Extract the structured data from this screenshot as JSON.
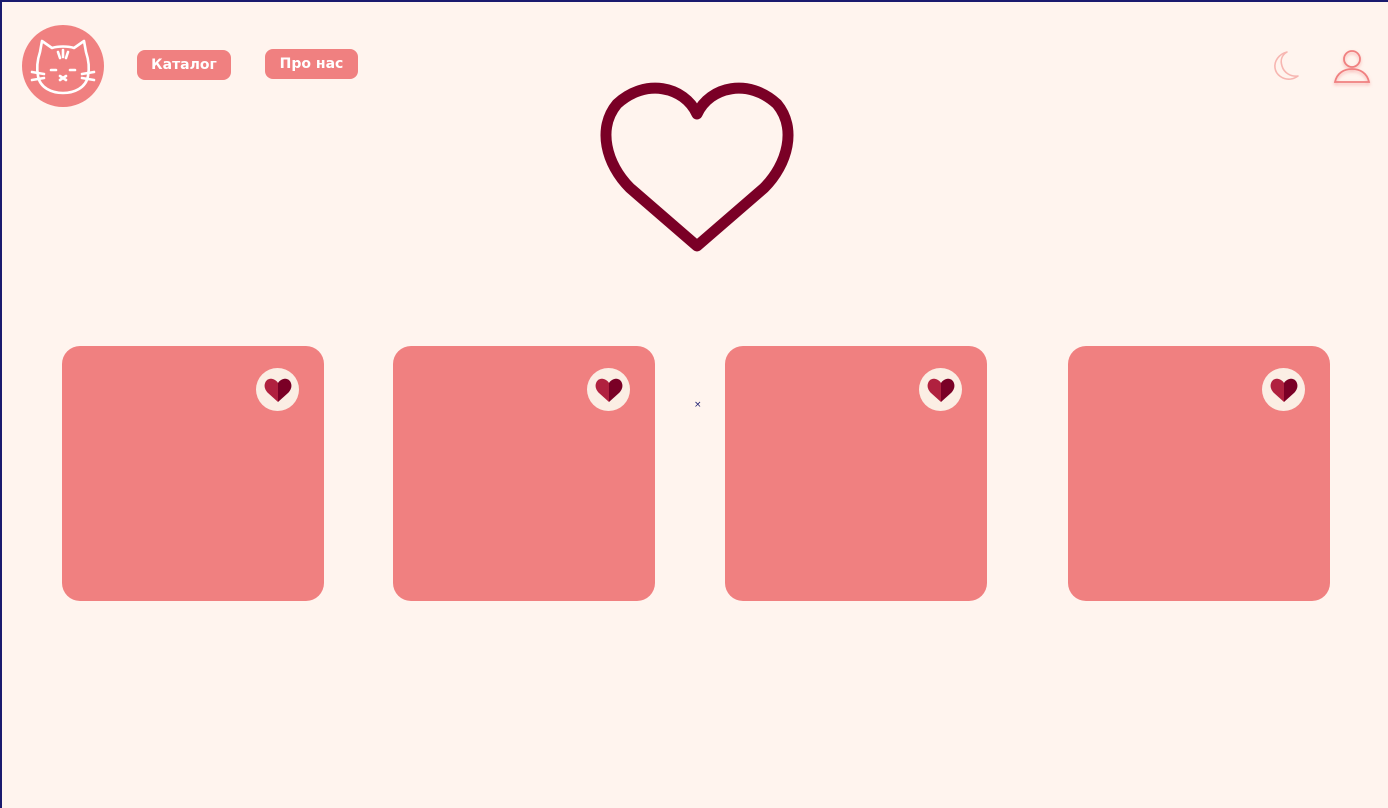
{
  "header": {
    "logo_icon": "cat-face-icon",
    "nav": {
      "catalog_label": "Каталог",
      "about_label": "Про нас"
    },
    "theme_toggle_icon": "moon-icon",
    "profile_icon": "user-icon"
  },
  "hero": {
    "icon": "heart-outline-icon"
  },
  "cards": [
    {
      "favorite_icon": "heart-half-icon"
    },
    {
      "favorite_icon": "heart-half-icon"
    },
    {
      "favorite_icon": "heart-half-icon"
    },
    {
      "favorite_icon": "heart-half-icon"
    }
  ],
  "cursor_glyph": "×",
  "colors": {
    "background": "#fff4ee",
    "accent": "#f08080",
    "heart_dark": "#7a0026",
    "heart_mid": "#b0213f",
    "fav_button_bg": "#fbeee4"
  }
}
